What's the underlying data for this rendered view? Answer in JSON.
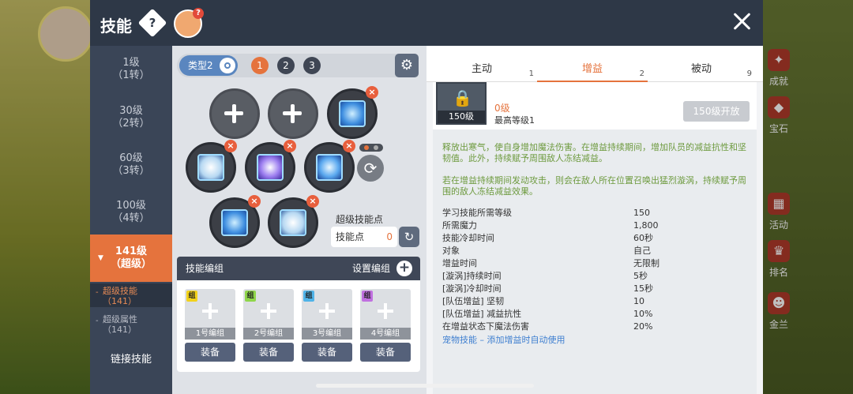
{
  "window": {
    "title": "技能"
  },
  "left_nav": {
    "items": [
      {
        "level": "1级",
        "sub": "（1转）"
      },
      {
        "level": "30级",
        "sub": "（2转）"
      },
      {
        "level": "60级",
        "sub": "（3转）"
      },
      {
        "level": "100级",
        "sub": "（4转）"
      },
      {
        "level": "141级",
        "sub": "（超级）"
      }
    ],
    "subitems": [
      {
        "name": "超级技能",
        "sub": "（141）"
      },
      {
        "name": "超级属性",
        "sub": "（141）"
      }
    ],
    "link_skill": "链接技能"
  },
  "middle": {
    "type_label": "类型2",
    "pages": [
      "1",
      "2",
      "3"
    ],
    "super_points_title": "超级技能点",
    "points_label": "技能点",
    "points_value": "0",
    "presets": {
      "title": "技能编组",
      "settings": "设置编组",
      "tag": "组",
      "tag_colors": [
        "#f2d21b",
        "#8fd64a",
        "#4fb3e8",
        "#c070e0"
      ],
      "items": [
        "1号编组",
        "2号编组",
        "3号编组",
        "4号编组"
      ],
      "equip": "装备"
    }
  },
  "right": {
    "tabs": [
      {
        "label": "主动",
        "count": "1"
      },
      {
        "label": "增益",
        "count": "2"
      },
      {
        "label": "被动",
        "count": "9"
      }
    ],
    "skill": {
      "lock_level": "150级",
      "current_level": "0级",
      "max_level": "最高等级1",
      "unlock_button": "150级开放",
      "desc1": "释放出寒气，使自身增加魔法伤害。在增益持续期间，增加队员的减益抗性和坚韧值。此外，持续赋予周围敌人冻结减益。",
      "desc2": "若在增益持续期间发动攻击，则会在敌人所在位置召唤出猛烈漩涡，持续赋予周围的敌人冻结减益效果。",
      "stats": [
        {
          "k": "学习技能所需等级",
          "v": "150"
        },
        {
          "k": "所需魔力",
          "v": "1,800"
        },
        {
          "k": "技能冷却时间",
          "v": "60秒"
        },
        {
          "k": "对象",
          "v": "自己"
        },
        {
          "k": "增益时间",
          "v": "无限制"
        },
        {
          "k": "[漩涡]持续时间",
          "v": "5秒"
        },
        {
          "k": "[漩涡]冷却时间",
          "v": "15秒"
        },
        {
          "k": "[队伍增益] 坚韧",
          "v": "10"
        },
        {
          "k": "[队伍增益] 减益抗性",
          "v": "10%"
        },
        {
          "k": "在增益状态下魔法伤害",
          "v": "20%"
        }
      ],
      "pet_link": "宠物技能 – 添加增益时自动使用"
    }
  },
  "background": {
    "side_labels": [
      "成就",
      "宝石",
      "活动",
      "排名",
      "金兰"
    ]
  },
  "colors": {
    "accent": "#e5733d",
    "header": "#2e3847",
    "nav": "#3a4557",
    "desc_green": "#6d9a3e",
    "link_blue": "#3f7fd0"
  }
}
